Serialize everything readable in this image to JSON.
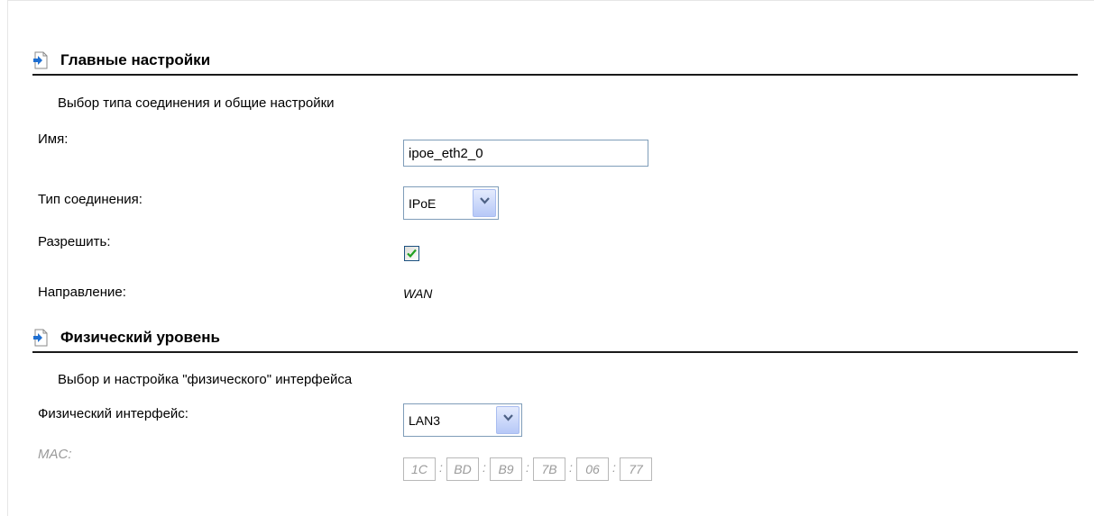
{
  "main_settings": {
    "title": "Главные настройки",
    "subtitle": "Выбор типа соединения и общие настройки",
    "name_label": "Имя:",
    "name_value": "ipoe_eth2_0",
    "conn_type_label": "Тип соединения:",
    "conn_type_value": "IPoE",
    "enable_label": "Разрешить:",
    "enable_checked": true,
    "direction_label": "Направление:",
    "direction_value": "WAN"
  },
  "physical": {
    "title": "Физический уровень",
    "subtitle": "Выбор и настройка \"физического\" интерфейса",
    "iface_label": "Физический интерфейс:",
    "iface_value": "LAN3",
    "mac_label": "MAC:",
    "mac": [
      "1C",
      "BD",
      "B9",
      "7B",
      "06",
      "77"
    ],
    "mac_separator": ":"
  },
  "icons": {
    "section_icon": "page-arrow-icon",
    "dropdown_icon": "chevron-down-icon",
    "check_icon": "checkmark-icon"
  },
  "colors": {
    "checkmark": "#21a121",
    "icon_arrow": "#1f6fd1",
    "input_border": "#7f9db9",
    "disabled_text": "#9a9a9a"
  }
}
